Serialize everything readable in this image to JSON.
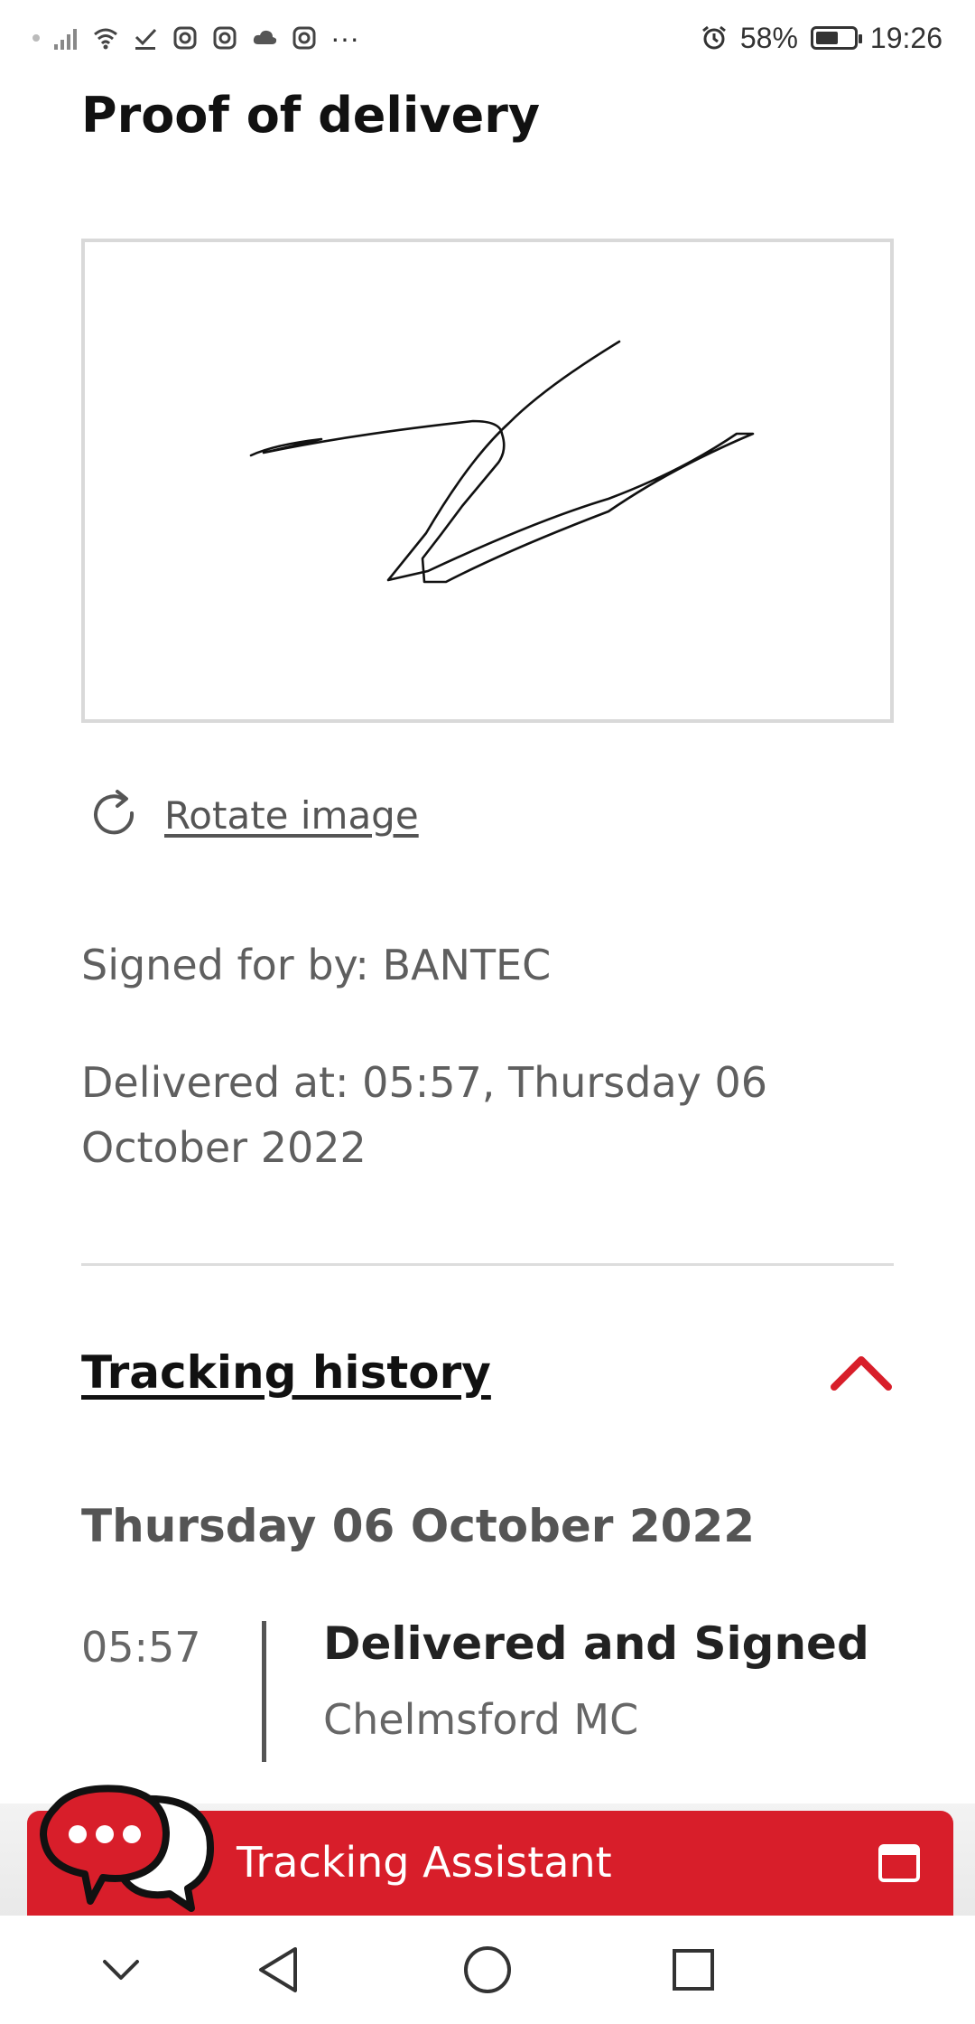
{
  "status_bar": {
    "battery": "58%",
    "time": "19:26",
    "overflow": "···"
  },
  "page": {
    "title": "Proof of delivery",
    "rotate_label": "Rotate image",
    "signed_for": "Signed for by: BANTEC",
    "delivered_at": "Delivered at: 05:57, Thursday 06 October 2022"
  },
  "tracking": {
    "title": "Tracking history",
    "date_heading": "Thursday 06 October 2022",
    "events": [
      {
        "time": "05:57",
        "status": "Delivered and Signed",
        "location": "Chelmsford MC"
      }
    ]
  },
  "assistant": {
    "label": "Tracking Assistant"
  },
  "colors": {
    "brand_red": "#d81e2a"
  }
}
